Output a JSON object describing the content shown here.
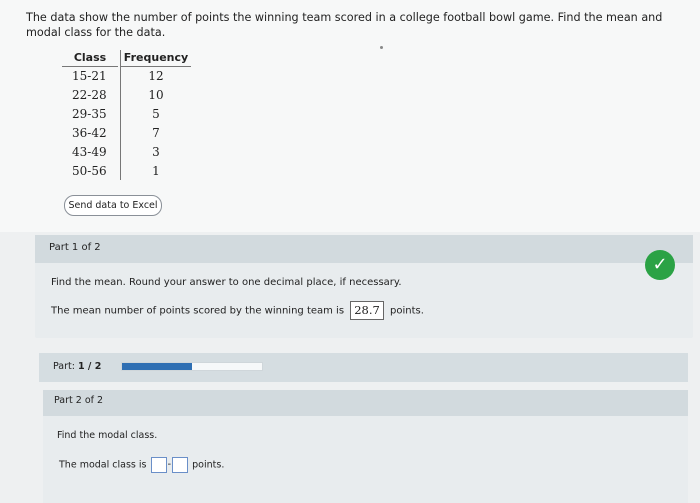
{
  "problem": {
    "text": "The data show the number of points the winning team scored in a college football bowl game. Find the mean and modal class for the data."
  },
  "table": {
    "headers": [
      "Class",
      "Frequency"
    ],
    "classes": [
      "15-21",
      "22-28",
      "29-35",
      "36-42",
      "43-49",
      "50-56"
    ],
    "frequencies": [
      "12",
      "10",
      "5",
      "7",
      "3",
      "1"
    ]
  },
  "excel_button": "Send data to Excel",
  "part1": {
    "heading": "Part 1 of 2",
    "instruction": "Find the mean. Round your answer to one decimal place, if necessary.",
    "answer_prefix": "The mean number of points scored by the winning team is",
    "answer_value": "28.7",
    "answer_suffix": "points.",
    "status_icon": "check-icon",
    "status_color": "#2ba245"
  },
  "progress": {
    "label": "Part:",
    "value": "1 / 2",
    "fraction": 0.5
  },
  "part2": {
    "heading": "Part 2 of 2",
    "instruction": "Find the modal class.",
    "answer_prefix": "The modal class is",
    "separator": "-",
    "answer_suffix": "points."
  }
}
